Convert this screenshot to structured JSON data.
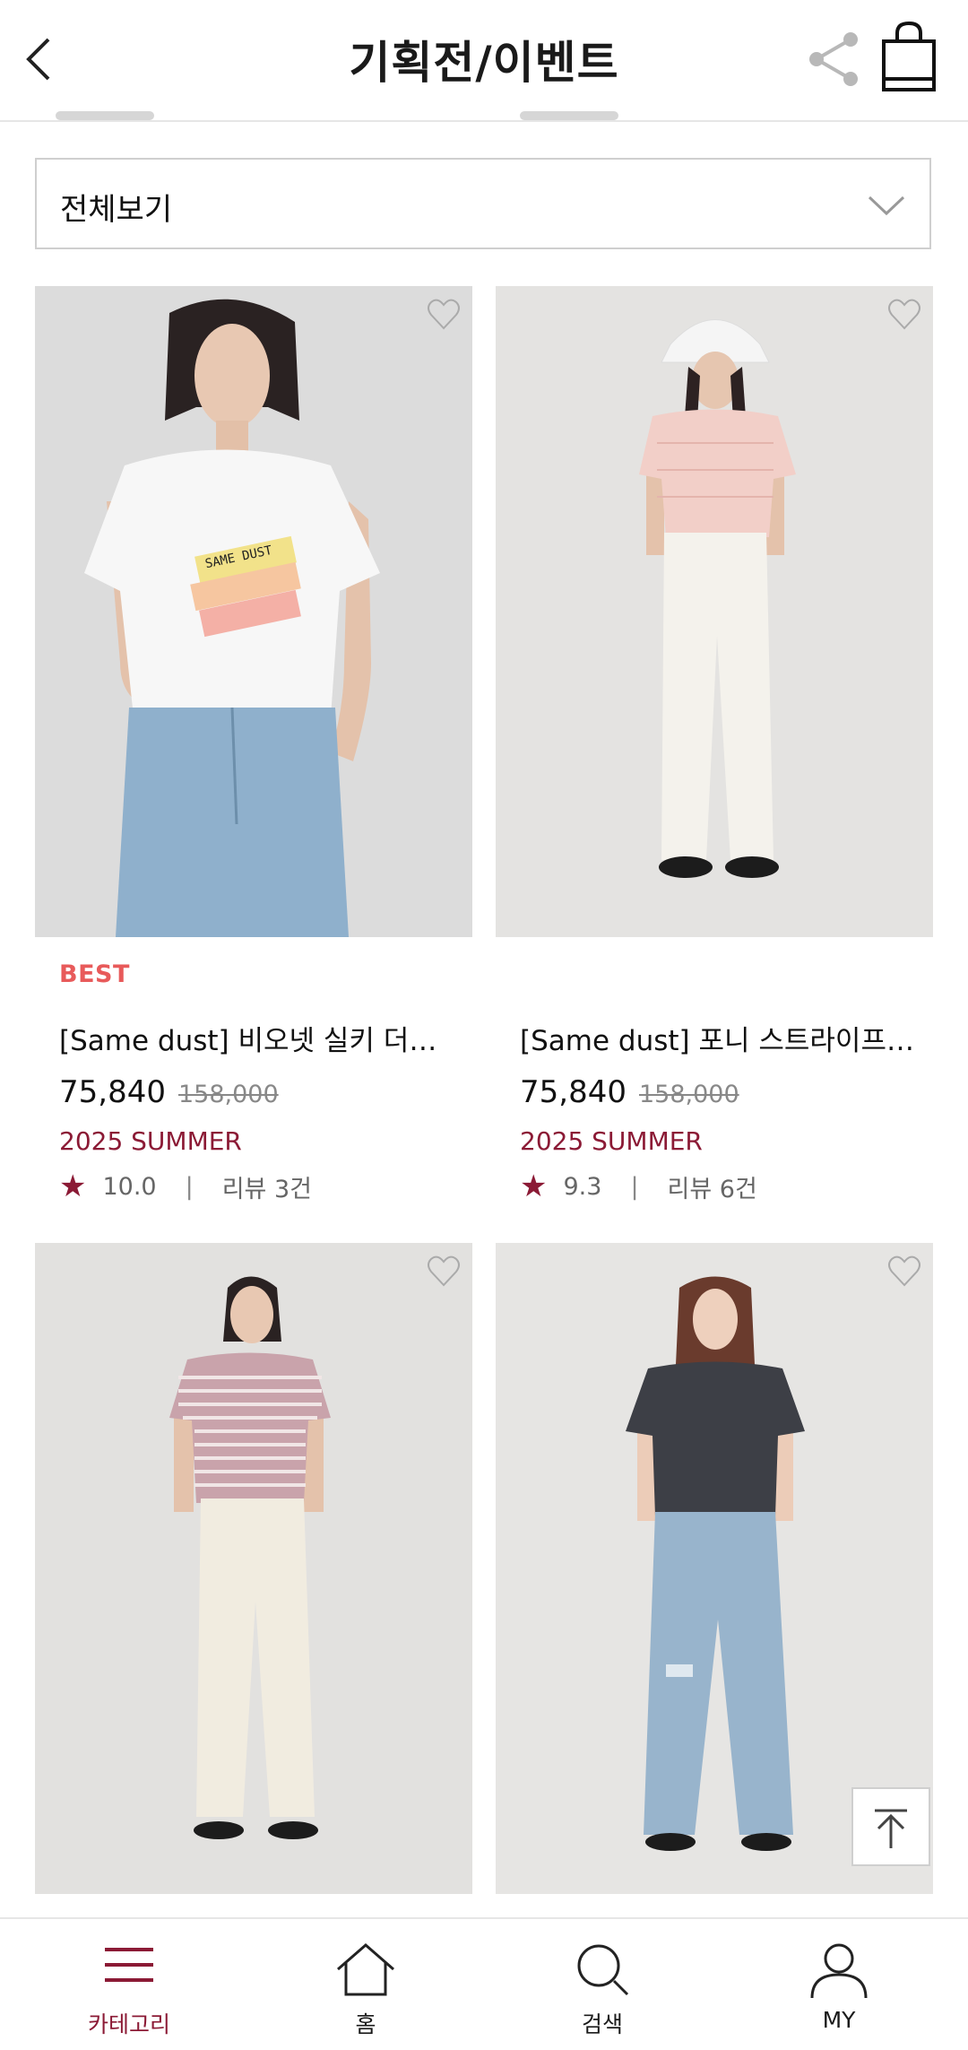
{
  "header": {
    "title": "기획전/이벤트"
  },
  "filter": {
    "selected": "전체보기"
  },
  "colors": {
    "accent": "#8b1a35",
    "badge": "#e85a5a"
  },
  "products": [
    {
      "badge": "BEST",
      "name": "[Same dust] 비오넷 실키 더블…",
      "price": "75,840",
      "original_price": "158,000",
      "season": "2025 SUMMER",
      "score": "10.0",
      "reviews": "리뷰 3건"
    },
    {
      "badge": "",
      "name": "[Same dust] 포니 스트라이프 …",
      "price": "75,840",
      "original_price": "158,000",
      "season": "2025 SUMMER",
      "score": "9.3",
      "reviews": "리뷰 6건"
    },
    {
      "badge": "",
      "name": "",
      "price": "",
      "original_price": "",
      "season": "",
      "score": "",
      "reviews": ""
    },
    {
      "badge": "",
      "name": "",
      "price": "",
      "original_price": "",
      "season": "",
      "score": "",
      "reviews": ""
    }
  ],
  "nav": {
    "items": [
      {
        "label": "카테고리",
        "icon": "menu-icon",
        "active": true
      },
      {
        "label": "홈",
        "icon": "home-icon",
        "active": false
      },
      {
        "label": "검색",
        "icon": "search-icon",
        "active": false
      },
      {
        "label": "MY",
        "icon": "user-icon",
        "active": false
      }
    ]
  }
}
